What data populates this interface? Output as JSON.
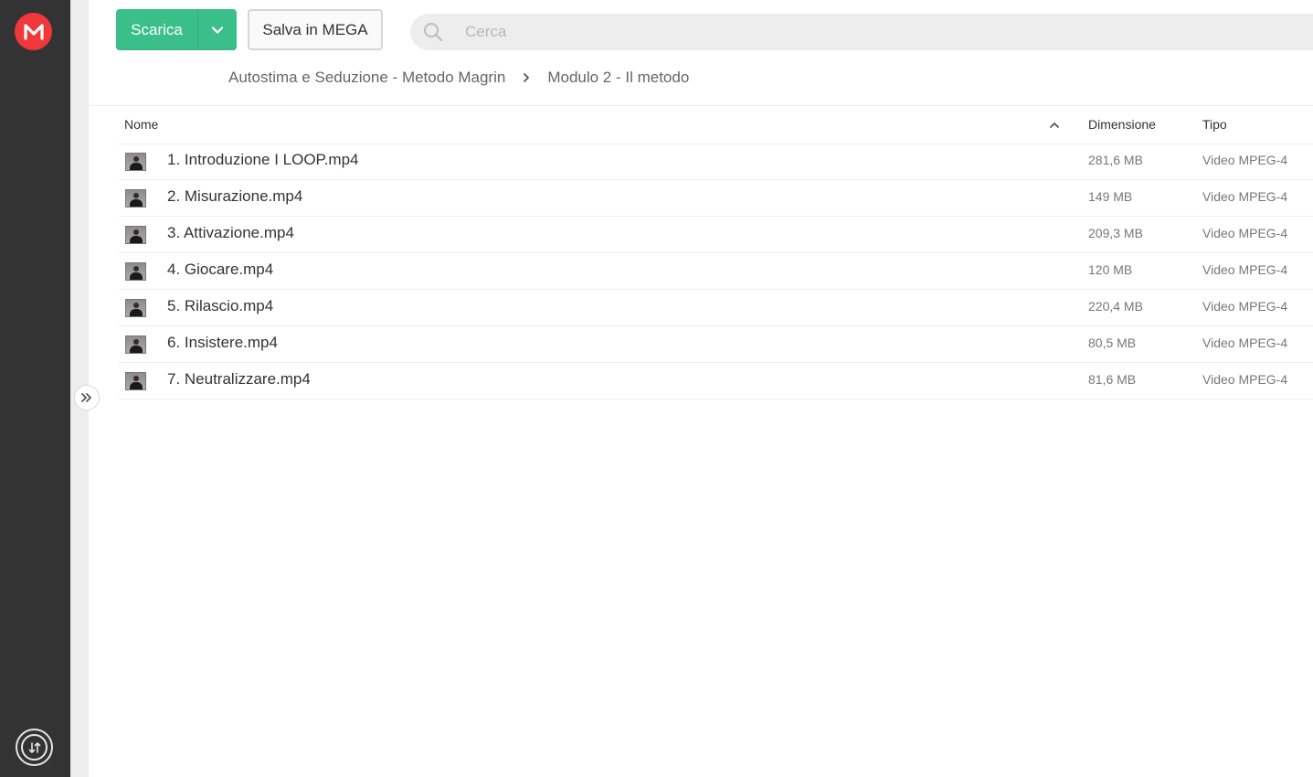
{
  "brand": {
    "color": "#f0373a"
  },
  "toolbar": {
    "download_label": "Scarica",
    "save_label": "Salva in MEGA"
  },
  "search": {
    "placeholder": "Cerca"
  },
  "breadcrumb": [
    "Autostima e Seduzione - Metodo Magrin",
    "Modulo 2 - Il metodo"
  ],
  "table": {
    "columns": {
      "name": "Nome",
      "size": "Dimensione",
      "type": "Tipo"
    },
    "sort": {
      "column": "Nome",
      "direction": "ascending"
    },
    "rows": [
      {
        "name": "1. Introduzione I LOOP.mp4",
        "size": "281,6 MB",
        "type": "Video MPEG-4"
      },
      {
        "name": "2. Misurazione.mp4",
        "size": "149 MB",
        "type": "Video MPEG-4"
      },
      {
        "name": "3. Attivazione.mp4",
        "size": "209,3 MB",
        "type": "Video MPEG-4"
      },
      {
        "name": "4. Giocare.mp4",
        "size": "120 MB",
        "type": "Video MPEG-4"
      },
      {
        "name": "5. Rilascio.mp4",
        "size": "220,4 MB",
        "type": "Video MPEG-4"
      },
      {
        "name": "6. Insistere.mp4",
        "size": "80,5 MB",
        "type": "Video MPEG-4"
      },
      {
        "name": "7. Neutralizzare.mp4",
        "size": "81,6 MB",
        "type": "Video MPEG-4"
      }
    ]
  },
  "icons": {
    "logo": "mega-logo-icon",
    "dropdown": "chevron-down-icon",
    "search": "search-icon",
    "breadcrumb_separator": "chevron-right-icon",
    "sort": "sort-ascending-icon",
    "expand_sidebar": "double-chevron-right-icon",
    "transfers": "transfers-icon",
    "thumbnail": "video-thumbnail-icon"
  }
}
